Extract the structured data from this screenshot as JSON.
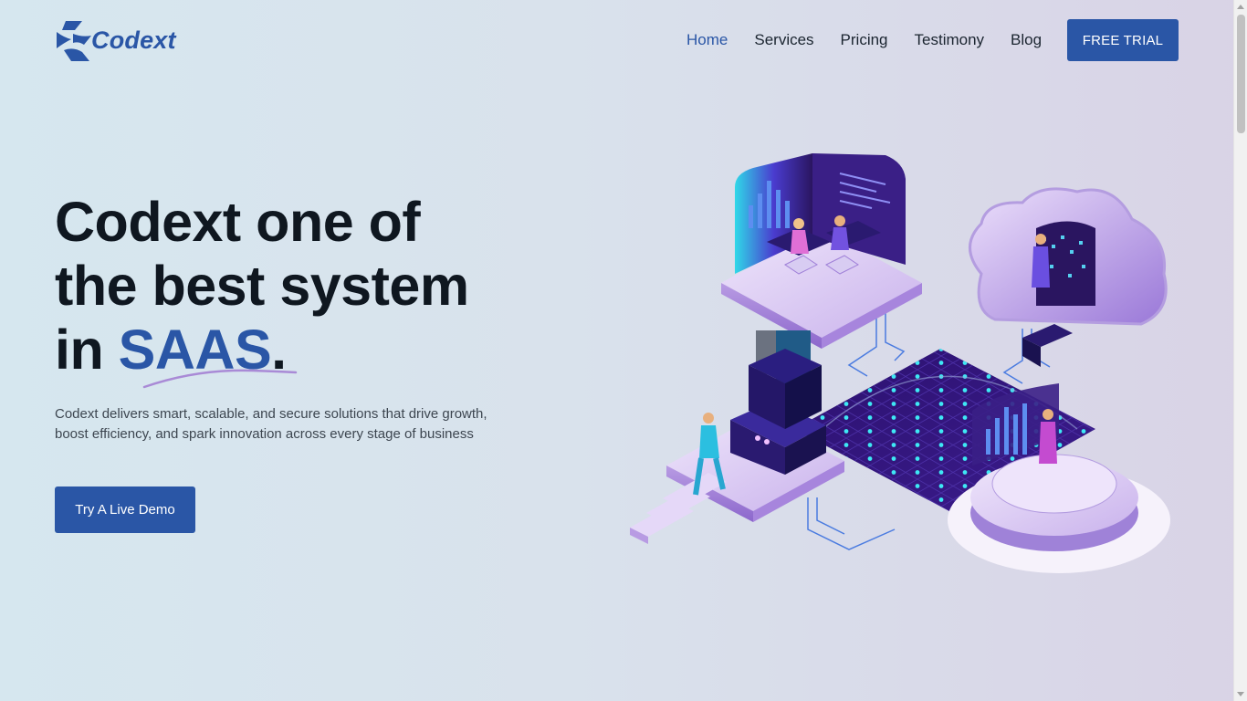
{
  "brand": {
    "name": "Codext",
    "color": "#2a56a6"
  },
  "nav": {
    "items": [
      {
        "label": "Home",
        "active": true
      },
      {
        "label": "Services",
        "active": false
      },
      {
        "label": "Pricing",
        "active": false
      },
      {
        "label": "Testimony",
        "active": false
      },
      {
        "label": "Blog",
        "active": false
      }
    ],
    "cta_label": "FREE TRIAL"
  },
  "hero": {
    "title_line1": "Codext one of",
    "title_line2": "the best system",
    "title_line3_prefix": "in ",
    "title_accent": "SAAS",
    "title_suffix": ".",
    "description": "Codext delivers smart, scalable, and secure solutions that drive growth, boost efficiency, and spark innovation across every stage of business",
    "demo_label": "Try A Live Demo"
  },
  "illustration": {
    "icon": "isometric-saas-illustration"
  }
}
